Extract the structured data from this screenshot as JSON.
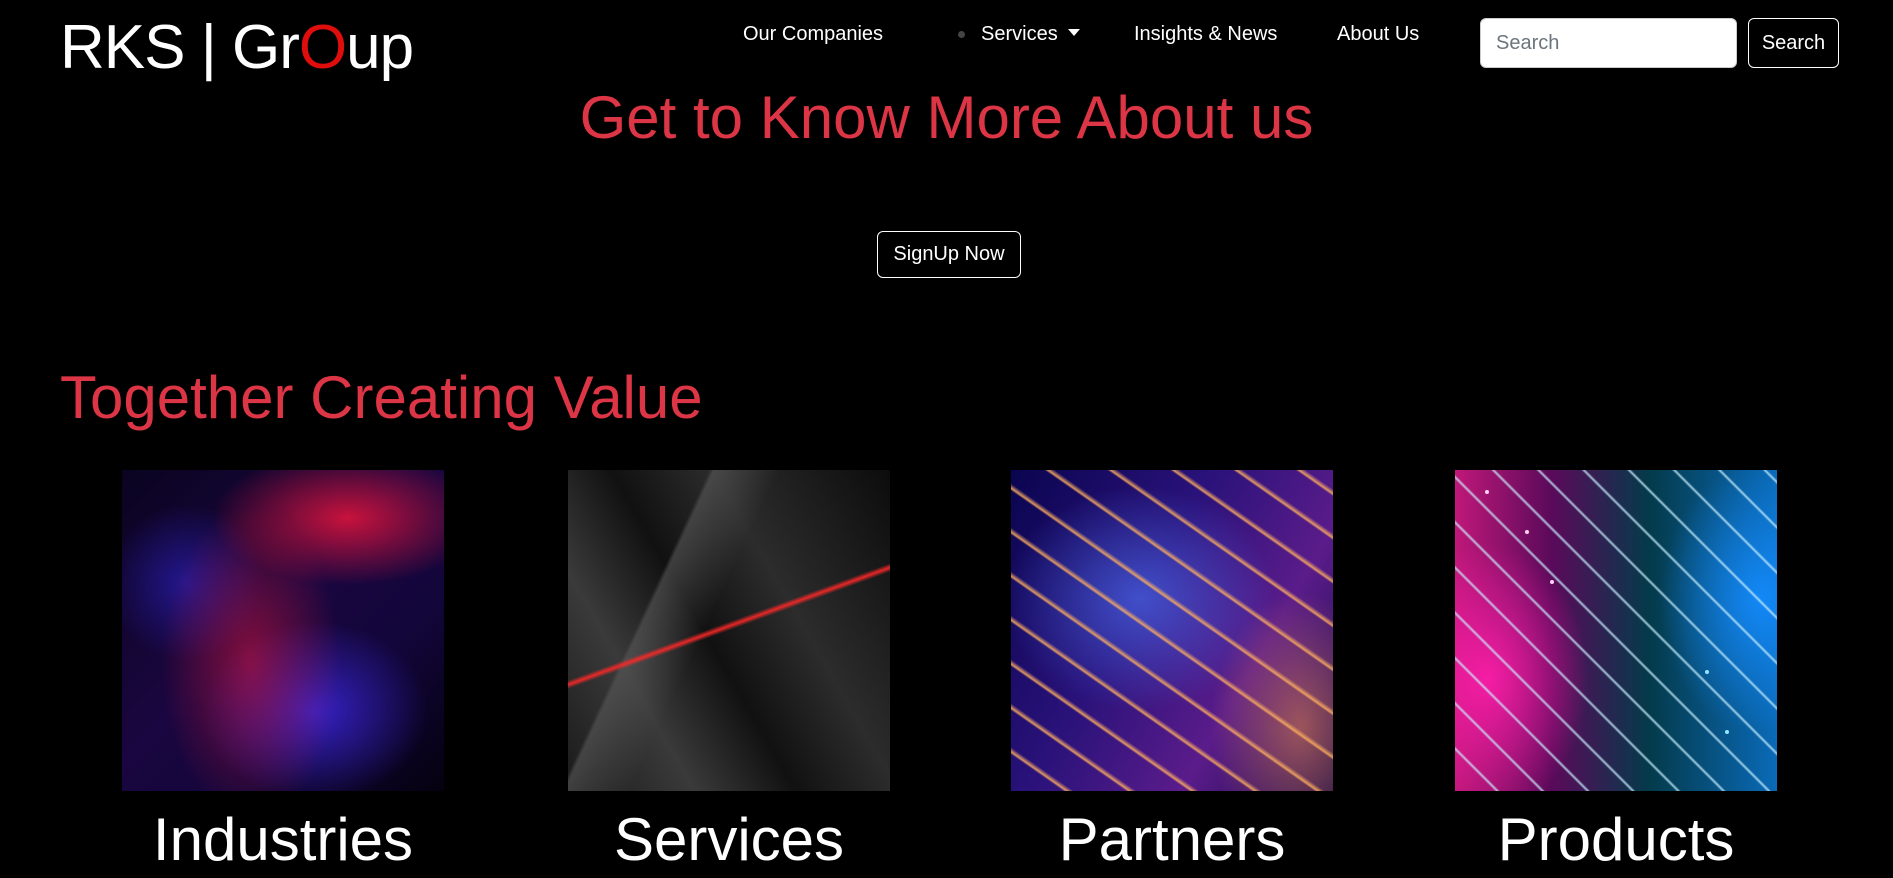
{
  "brand": {
    "prefix": "RKS | Gr",
    "accent": "O",
    "suffix": "up"
  },
  "nav": {
    "items": [
      {
        "label": "Our Companies"
      },
      {
        "label": "Services"
      },
      {
        "label": "Insights & News"
      },
      {
        "label": "About Us"
      }
    ],
    "search_placeholder": "Search",
    "search_button": "Search"
  },
  "hero": {
    "title": "Get to Know More About us",
    "signup_button": "SignUp Now"
  },
  "section": {
    "title": "Together Creating Value",
    "cards": [
      {
        "label": "Industries"
      },
      {
        "label": "Services"
      },
      {
        "label": "Partners"
      },
      {
        "label": "Products"
      }
    ]
  },
  "colors": {
    "background": "#000000",
    "accent_red": "#dc3545",
    "brand_o": "#e00d0d",
    "text": "#ffffff"
  },
  "icons": {
    "services_dropdown": "caret-down-icon"
  }
}
